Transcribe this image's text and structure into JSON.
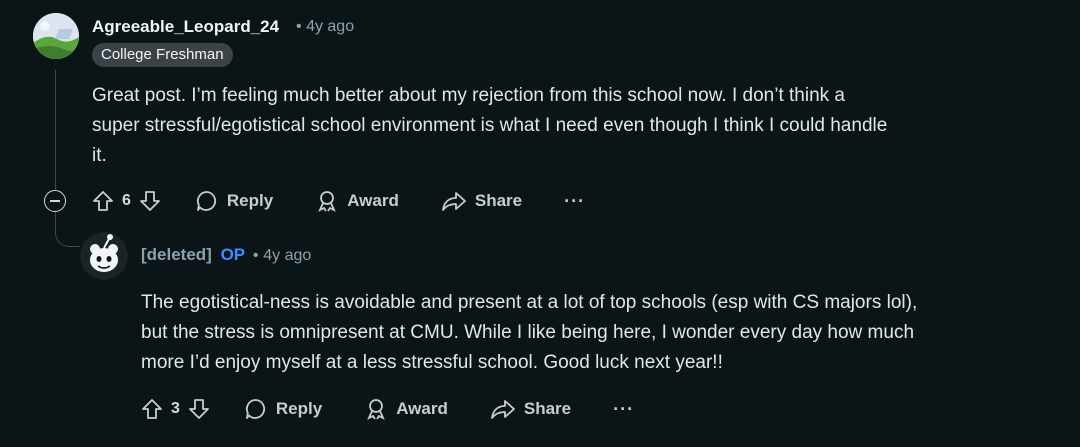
{
  "comments": [
    {
      "username": "Agreeable_Leopard_24",
      "time": "4y ago",
      "flair": "College Freshman",
      "body_lines": [
        "Great post. I’m feeling much better about my rejection from this school now. I don’t think a",
        "super stressful/egotistical school environment is what I need even though I think I could handle",
        "it."
      ],
      "votes": "6",
      "reply_label": "Reply",
      "award_label": "Award",
      "share_label": "Share",
      "more_label": "···"
    },
    {
      "username": "[deleted]",
      "op_badge": "OP",
      "time": "4y ago",
      "body_lines": [
        "The egotistical-ness is avoidable and present at a lot of top schools (esp with CS majors lol),",
        "but the stress is omnipresent at CMU. While I like being here, I wonder every day how much",
        "more I’d enjoy myself at a less stressful school. Good luck next year!!"
      ],
      "votes": "3",
      "reply_label": "Reply",
      "award_label": "Award",
      "share_label": "Share",
      "more_label": "···"
    }
  ],
  "colors": {
    "background": "#0b1416",
    "op_blue": "#3b8eff",
    "thread_line": "#3e4a4f"
  }
}
